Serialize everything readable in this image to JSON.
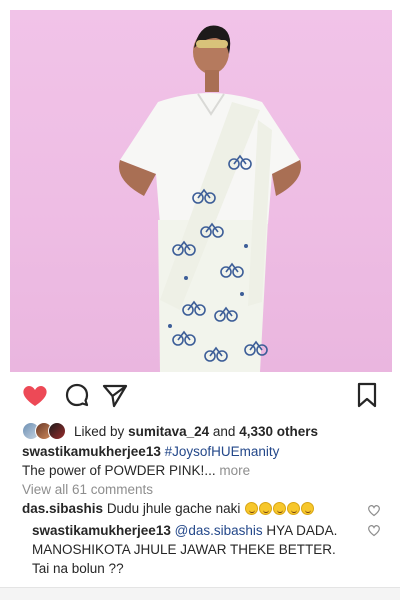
{
  "post": {
    "likes": {
      "prefix": "Liked by",
      "user": "sumitava_24",
      "joiner": "and",
      "others": "4,330 others"
    },
    "caption": {
      "username": "swastikamukherjee13",
      "hashtag": "#JoysofHUEmanity",
      "text": "The power of POWDER PINK!",
      "ellipsis": "...",
      "more": "more"
    },
    "view_all_comments": "View all 61 comments",
    "comments": [
      {
        "username": "das.sibashis",
        "text": "Dudu jhule gache naki",
        "emoji_count": 5,
        "emoji": "face-with-tears-of-joy-icon"
      }
    ],
    "reply": {
      "username": "swastikamukherjee13",
      "mention": "@das.sibashis",
      "line1": "HYA DADA.",
      "line2": "MANOSHIKOTA JHULE JAWAR THEKE BETTER.",
      "line3": "Tai na bolun ??"
    }
  },
  "colors": {
    "like": "#ed4956",
    "background_pink": "#eebde4",
    "link": "#24488a",
    "muted": "#8e8e8e"
  },
  "icons": [
    "heart-filled-icon",
    "comment-bubble-icon",
    "share-paper-plane-icon",
    "bookmark-icon"
  ]
}
